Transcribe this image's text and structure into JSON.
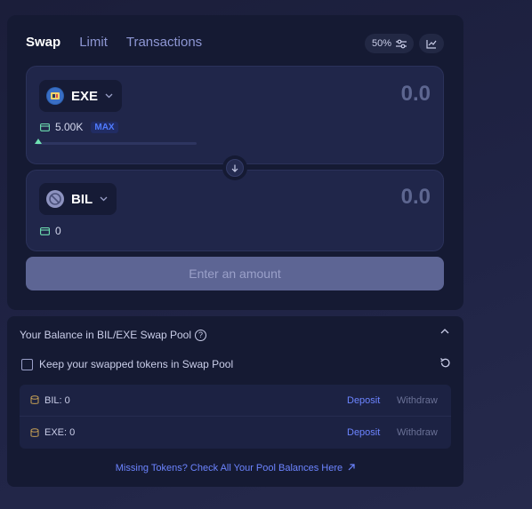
{
  "tabs": [
    {
      "label": "Swap",
      "active": true
    },
    {
      "label": "Limit",
      "active": false
    },
    {
      "label": "Transactions",
      "active": false
    }
  ],
  "slippage": {
    "label": "50%",
    "icon": "sliders-icon"
  },
  "chart_button": {
    "icon": "chart-line-icon"
  },
  "from": {
    "token": "EXE",
    "amount_placeholder": "0.0",
    "balance": "5.00K",
    "max_label": "MAX",
    "slider_percent": 0
  },
  "to": {
    "token": "BIL",
    "amount_placeholder": "0.0",
    "balance": "0"
  },
  "action_button": {
    "label": "Enter an amount"
  },
  "pool": {
    "title": "Your Balance in BIL/EXE Swap Pool",
    "help_icon": "?",
    "keep_label": "Keep your swapped tokens in Swap Pool",
    "rows": [
      {
        "label": "BIL: 0",
        "deposit": "Deposit",
        "withdraw": "Withdraw"
      },
      {
        "label": "EXE: 0",
        "deposit": "Deposit",
        "withdraw": "Withdraw"
      }
    ],
    "missing_link": "Missing Tokens? Check All Your Pool Balances Here"
  },
  "colors": {
    "accent": "#6c84ff",
    "background": "#151a33",
    "panel": "#20264a"
  }
}
